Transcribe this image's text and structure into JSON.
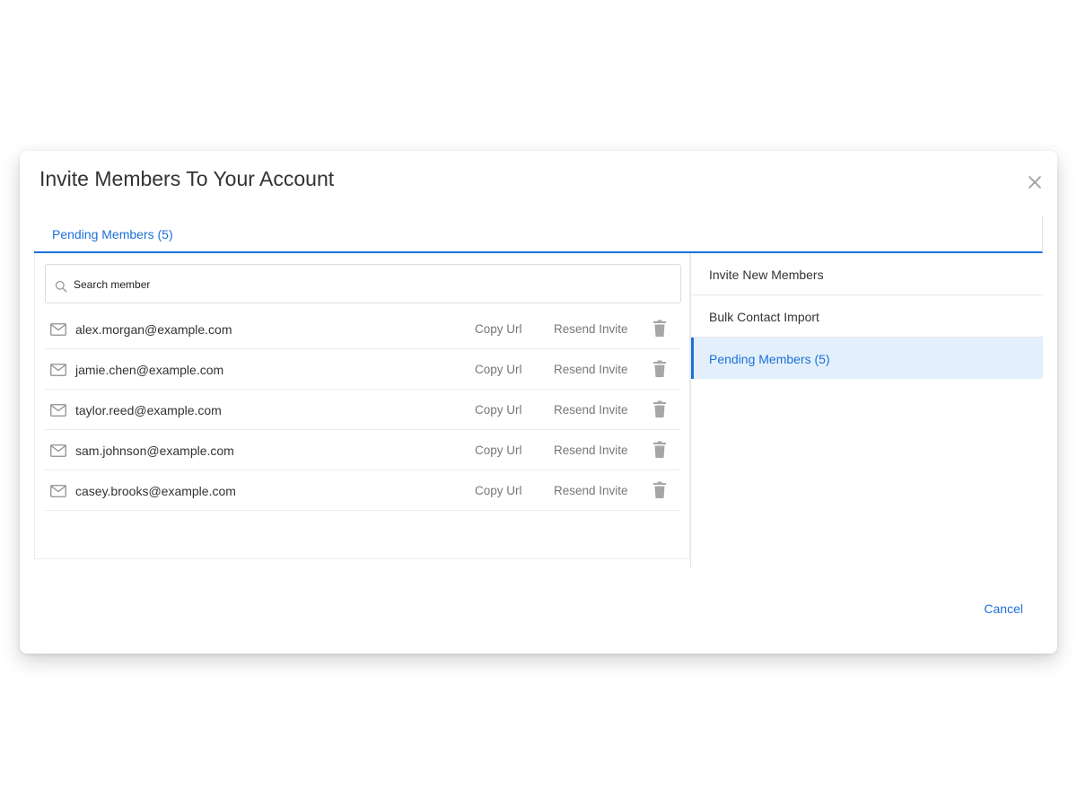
{
  "modal": {
    "title": "Invite Members To Your Account",
    "close_icon": "close-icon"
  },
  "tabs": [
    {
      "label": "Pending Members (5)",
      "active": true
    }
  ],
  "search": {
    "placeholder": "Search member",
    "value": "",
    "icon": "search-icon"
  },
  "members": [
    {
      "email": "alex.morgan@example.com",
      "copy_label": "Copy Url",
      "resend_label": "Resend Invite"
    },
    {
      "email": "jamie.chen@example.com",
      "copy_label": "Copy Url",
      "resend_label": "Resend Invite"
    },
    {
      "email": "taylor.reed@example.com",
      "copy_label": "Copy Url",
      "resend_label": "Resend Invite"
    },
    {
      "email": "sam.johnson@example.com",
      "copy_label": "Copy Url",
      "resend_label": "Resend Invite"
    },
    {
      "email": "casey.brooks@example.com",
      "copy_label": "Copy Url",
      "resend_label": "Resend Invite"
    }
  ],
  "side_menu": {
    "items": [
      {
        "label": "Invite New Members",
        "active": false
      },
      {
        "label": "Bulk Contact Import",
        "active": false
      },
      {
        "label": "Pending Members (5)",
        "active": true
      }
    ]
  },
  "footer": {
    "cancel_label": "Cancel"
  },
  "colors": {
    "accent": "#1e6fd9",
    "active_bg": "#e3f0fc",
    "text": "#333333",
    "muted": "#777777",
    "icon_gray": "#a6a6a6"
  }
}
